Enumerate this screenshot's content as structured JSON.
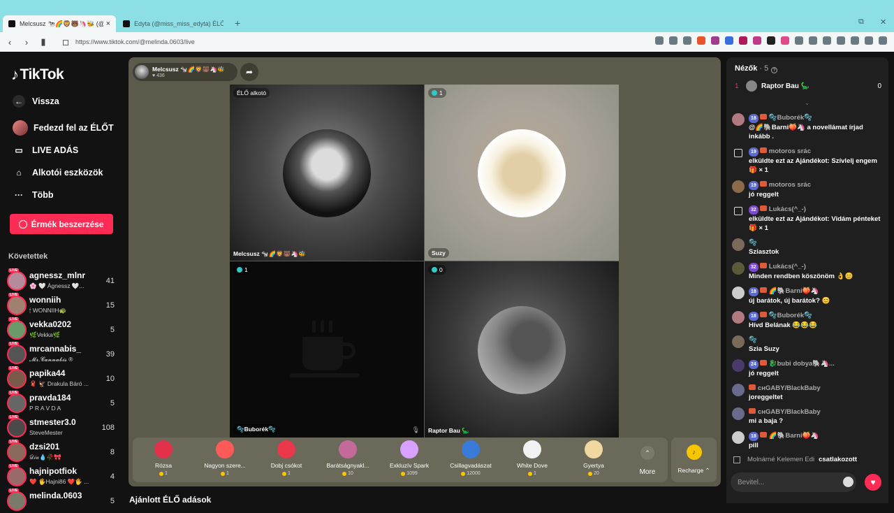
{
  "browser": {
    "tabs": [
      {
        "title": "Melcsusz 🐄🌈🦁🐻🦄🐝 (@",
        "active": true
      },
      {
        "title": "Edyta (@miss_miss_edyta) ÉLŐ ad",
        "active": false
      }
    ],
    "url": "https://www.tiktok.com/@melinda.0603/live"
  },
  "sidebar": {
    "logo": "TikTok",
    "back": "Vissza",
    "nav": [
      {
        "label": "Fedezd fel az ÉLŐT"
      },
      {
        "label": "LIVE ADÁS"
      },
      {
        "label": "Alkotói eszközök"
      },
      {
        "label": "Több"
      }
    ],
    "coins_button": "Érmék beszerzése",
    "following_title": "Követettek",
    "following": [
      {
        "name": "agnessz_mlnr",
        "sub": "🌸 🤍 Ágnessz 🤍...",
        "count": "41",
        "live": "LIVE"
      },
      {
        "name": "wonniih",
        "sub": "🕯 WONNIIH🐢",
        "count": "15",
        "live": "LIVE"
      },
      {
        "name": "vekka0202",
        "sub": "🌿Vekka🌿",
        "count": "5",
        "live": "LIVE"
      },
      {
        "name": "mrcannabis_",
        "sub": "𝓜𝓻.𝓒𝓪𝓷𝓷𝓪𝓫𝓲𝓼 ®",
        "count": "39",
        "live": "LIVE"
      },
      {
        "name": "papika44",
        "sub": "🧣 🦅 Drakula Báró ...",
        "count": "10",
        "live": "LIVE"
      },
      {
        "name": "pravda184",
        "sub": "P R A V D A",
        "count": "5",
        "live": "LIVE"
      },
      {
        "name": "stmester3.0",
        "sub": "SteveMester",
        "count": "108",
        "live": "LIVE"
      },
      {
        "name": "dzsi201",
        "sub": "𝒟𝒾𝒶💧🥀🎀",
        "count": "8",
        "live": "LIVE"
      },
      {
        "name": "hajnipotfiok",
        "sub": "❤️ 🖐Hajni86 ❤️🖐 ...",
        "count": "4",
        "live": "LIVE"
      },
      {
        "name": "melinda.0603",
        "sub": "",
        "count": "5",
        "live": "LIVE"
      }
    ]
  },
  "stage": {
    "host_name": "Melcsusz 🐄🌈🦁🐻🦄🐝",
    "host_likes": "♥ 436",
    "cells": [
      {
        "badge": "ÉLŐ alkotó",
        "name": "Melcsusz 🐄🌈🦁🐻🦄🐝"
      },
      {
        "badge": "1",
        "name": "Suzy"
      },
      {
        "badge": "1",
        "name": "🫧Buborék🫧"
      },
      {
        "badge": "0",
        "name": "Raptor Bau 🦕"
      }
    ]
  },
  "gifts": [
    {
      "name": "Rózsa",
      "price": "1",
      "color": "#e0304a"
    },
    {
      "name": "Nagyon szere...",
      "price": "1",
      "color": "#ff5a5a"
    },
    {
      "name": "Dobj csókot",
      "price": "1",
      "color": "#e8384a"
    },
    {
      "name": "Barátságnyakl...",
      "price": "10",
      "color": "#c46a9a"
    },
    {
      "name": "Exkluzív Spark",
      "price": "1099",
      "color": "#d8a0ff"
    },
    {
      "name": "Csillagvadászat",
      "price": "12000",
      "color": "#3a7ad8"
    },
    {
      "name": "White Dove",
      "price": "1",
      "color": "#f2f2f2"
    },
    {
      "name": "Gyertya",
      "price": "20",
      "color": "#f0d8a0"
    }
  ],
  "gift_more": "More",
  "recharge": "Recharge ⌃",
  "suggested_title": "Ajánlott ÉLŐ adások",
  "chat": {
    "viewers_label": "Nézők",
    "viewers_count": "· 5",
    "top_viewer": {
      "rank": "1",
      "name": "Raptor Bau 🦕",
      "score": "0"
    },
    "messages": [
      {
        "level": "18",
        "user": "🫧Buborék🫧",
        "body": "@🌈🐘Barni🍑🦄 a novellámat írjad inkább ."
      },
      {
        "level": "19",
        "user": "motoros srác",
        "body": "elküldte ezt az Ajándékot: Szívlelj engem 🎁 × 1",
        "gift": true
      },
      {
        "level": "19",
        "user": "motoros srác",
        "body": "jó reggelt"
      },
      {
        "level": "32",
        "user": "Lukács(^_-)",
        "body": "elküldte ezt az Ajándékot: Vidám pénteket 🎁 × 1",
        "gift": true
      },
      {
        "level": "",
        "user": "🫧",
        "body": "Sziasztok"
      },
      {
        "level": "32",
        "user": "Lukács(^_-)",
        "body": "Minden rendben köszönöm 👌😊"
      },
      {
        "level": "18",
        "user": "🌈🐘Barni🍑🦄",
        "body": "új barátok, új barátok? 😊"
      },
      {
        "level": "18",
        "user": "🫧Buborék🫧",
        "body": "Hívd Belának 😂😂😂"
      },
      {
        "level": "",
        "user": "🫧",
        "body": "Szia Suzy"
      },
      {
        "level": "24",
        "user": "🐉bubi dobya🐘🦄...",
        "body": "jó reggelt"
      },
      {
        "level": "",
        "user": "ᴄʜGABY/BlackBaby",
        "body": "joreggeltet"
      },
      {
        "level": "",
        "user": "ᴄʜGABY/BlackBaby",
        "body": "mi a baja ?"
      },
      {
        "level": "18",
        "user": "🌈🐘Barni🍑🦄",
        "body": "pill"
      }
    ],
    "joined_user": "Molnárné Kelemen Edi",
    "joined_text": "csatlakozott",
    "input_placeholder": "Bevitel..."
  }
}
